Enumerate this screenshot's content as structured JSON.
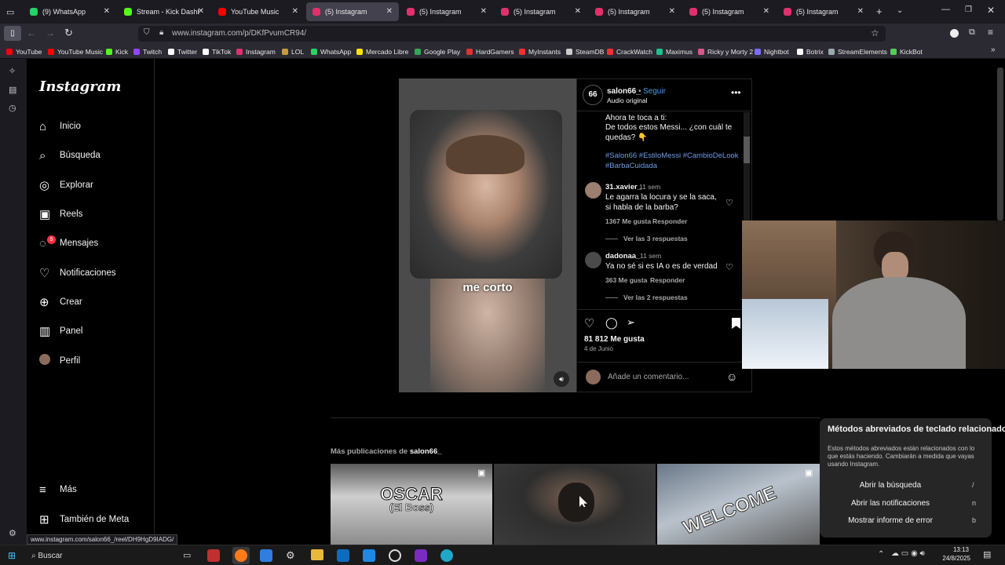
{
  "tabs": [
    {
      "label": "(9) WhatsApp",
      "color": "#25d366"
    },
    {
      "label": "Stream - Kick Dashboard",
      "color": "#53fc18"
    },
    {
      "label": "YouTube Music",
      "color": "#ff0000"
    },
    {
      "label": "(5) Instagram",
      "color": "#e1306c",
      "active": true
    },
    {
      "label": "(5) Instagram",
      "color": "#e1306c"
    },
    {
      "label": "(5) Instagram",
      "color": "#e1306c"
    },
    {
      "label": "(5) Instagram",
      "color": "#e1306c"
    },
    {
      "label": "(5) Instagram",
      "color": "#e1306c"
    },
    {
      "label": "(5) Instagram",
      "color": "#e1306c"
    }
  ],
  "url": "www.instagram.com/p/DKfPvumCR94/",
  "bookmarks": [
    "YouTube",
    "YouTube Music",
    "Kick",
    "Twitch",
    "Twitter",
    "TikTok",
    "Instagram",
    "LOL",
    "WhatsApp",
    "Mercado Libre",
    "Google Play",
    "HardGamers",
    "MyInstants",
    "SteamDB",
    "CrackWatch",
    "Maximus",
    "Ricky y Morty 2",
    "Nightbot",
    "Botrix",
    "StreamElements",
    "KickBot"
  ],
  "ig": {
    "logo": "Instagram",
    "nav": [
      "Inicio",
      "Búsqueda",
      "Explorar",
      "Reels",
      "Mensajes",
      "Notificaciones",
      "Crear",
      "Panel",
      "Perfil"
    ],
    "messages_badge": "5",
    "more": "Más",
    "meta": "También de Meta"
  },
  "post": {
    "username": "salon66_",
    "follow": "Seguir",
    "audio": "Audio original",
    "avatar_text": "66",
    "caption_1": "Ahora te toca a ti:",
    "caption_2": "De todos estos Messi... ¿con cuál te quedas? 👇",
    "hashtags": "#Salon66 #EstiloMessi #CambioDeLook #BarbaCuidada",
    "reel_caption": "me corto",
    "likes": "81 812 Me gusta",
    "date": "4 de Junio",
    "comment_placeholder": "Añade un comentario...",
    "comments": [
      {
        "user": "31.xavier_",
        "time": "11 sem",
        "text": "Le agarra la locura y se la saca, si habla de la barba?",
        "likes": "1367 Me gusta",
        "reply": "Responder",
        "replies": "Ver las 3 respuestas"
      },
      {
        "user": "dadonaa_",
        "time": "11 sem",
        "text": "Ya no sé si es IA o es de verdad",
        "likes": "363 Me gusta",
        "reply": "Responder",
        "replies": "Ver las 2 respuestas"
      }
    ]
  },
  "more_posts": {
    "label": "Más publicaciones de",
    "user": "salon66_",
    "thumb1_text": "OSCAR",
    "thumb1_sub": "(El Boss)",
    "thumb3_text": "WELCOME"
  },
  "popup": {
    "title": "Métodos abreviados de teclado relacionados",
    "desc": "Estos métodos abreviados están relacionados con lo que estás haciendo. Cambiarán a medida que vayas usando Instagram.",
    "rows": [
      {
        "label": "Abrir la búsqueda",
        "key": "/"
      },
      {
        "label": "Abrir las notificaciones",
        "key": "n"
      },
      {
        "label": "Mostrar informe de error",
        "key": "b"
      }
    ]
  },
  "status_url": "www.instagram.com/salon66_/reel/DH9HgD9IADG/",
  "taskbar": {
    "search": "Buscar",
    "time": "13:13",
    "date": "24/8/2025"
  }
}
